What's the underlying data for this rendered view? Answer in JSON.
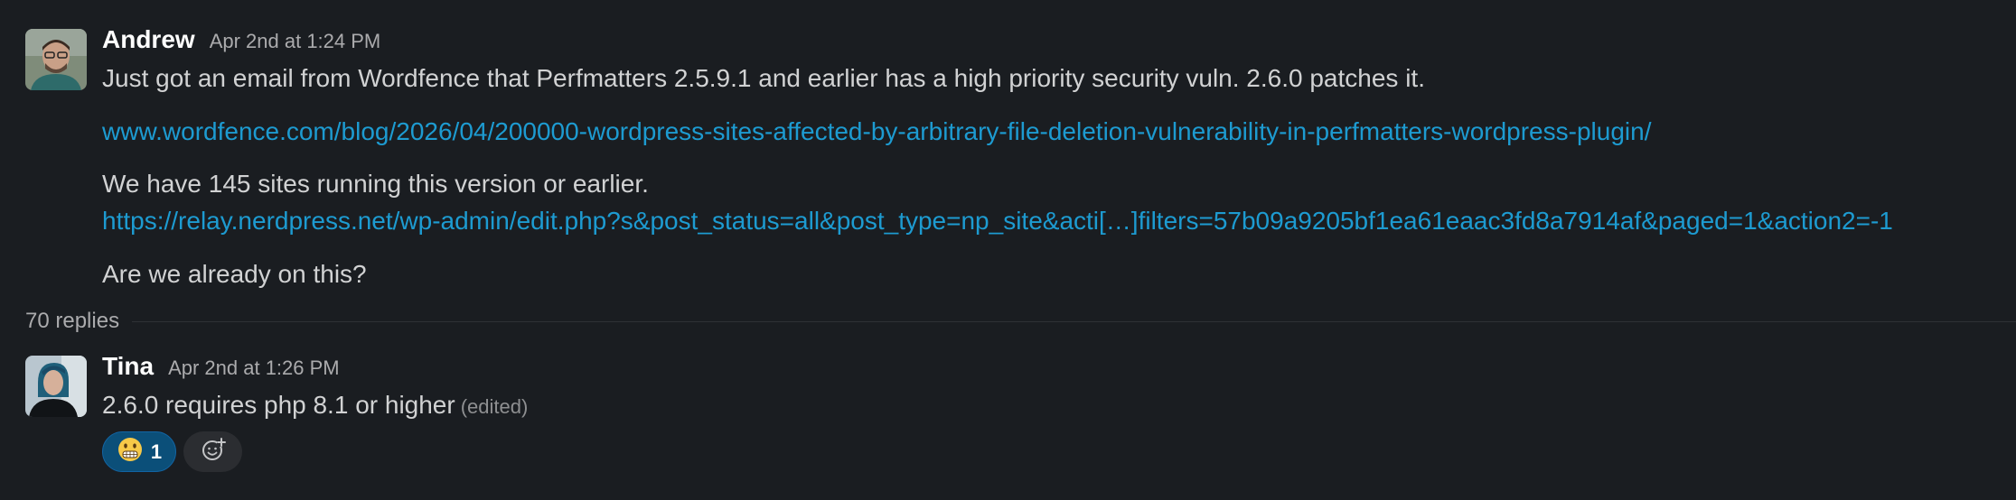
{
  "messages": [
    {
      "author": "Andrew",
      "timestamp": "Apr 2nd at 1:24 PM",
      "line1": "Just got an email from Wordfence that Perfmatters 2.5.9.1 and earlier has a high priority security vuln.  2.6.0 patches it.",
      "link1": "www.wordfence.com/blog/2026/04/200000-wordpress-sites-affected-by-arbitrary-file-deletion-vulnerability-in-perfmatters-wordpress-plugin/",
      "line2": "We have 145 sites running this version or earlier.",
      "link2": "https://relay.nerdpress.net/wp-admin/edit.php?s&post_status=all&post_type=np_site&acti[…]filters=57b09a9205bf1ea61eaac3fd8a7914af&paged=1&action2=-1",
      "line3": "Are we already on this?",
      "avatar_icon": "person-avatar"
    },
    {
      "author": "Tina",
      "timestamp": "Apr 2nd at 1:26 PM",
      "text": "2.6.0 requires php 8.1 or higher",
      "edited": "(edited)",
      "avatar_icon": "person-avatar"
    }
  ],
  "thread": {
    "replies": "70 replies"
  },
  "reactions": [
    {
      "emoji_icon": "grimacing-face-emoji",
      "count": "1"
    }
  ],
  "add_reaction_icon": "add-reaction-icon",
  "colors": {
    "background": "#1a1d21",
    "link": "#1d9bd1",
    "reaction_bg": "#0b4f79"
  }
}
